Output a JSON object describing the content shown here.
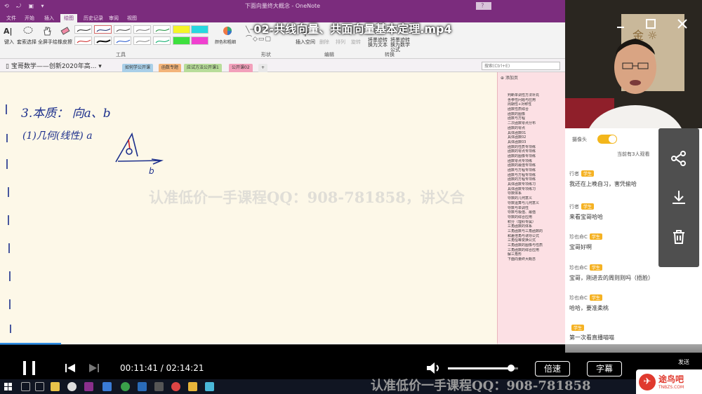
{
  "onenote": {
    "window_title": "下面向量终大概念 - OneNote",
    "quick_access": "⟲ ⤾ ▣ ▾",
    "help_label": "？",
    "tabs": [
      "文件",
      "开始",
      "插入",
      "绘图",
      "历史记录",
      "审阅",
      "视图"
    ],
    "active_tab": "绘图",
    "ribbon": {
      "tools": [
        "键入",
        "套索选择",
        "全屏手绘",
        "橡皮擦"
      ],
      "group_tools": "工具",
      "group_shapes": "形状",
      "group_edit": "编辑",
      "group_convert": "转换",
      "color_thickness": "颜色和粗细",
      "insert_space": "插入空间",
      "delete": "删除",
      "arrange": "排列",
      "rotate": "旋转",
      "ink_to_text": "将墨迹转换为文本",
      "ink_to_math": "将墨迹转换为数学公式"
    },
    "notebook_name": "宝哥数学——创新2020年高...",
    "sections": [
      {
        "label": "如何学公开课",
        "color": "#a9cfe8"
      },
      {
        "label": "函数专题",
        "color": "#f3b47a"
      },
      {
        "label": "应试方法公开课1",
        "color": "#b8dd9a"
      },
      {
        "label": "公开课02",
        "color": "#f2a0bb"
      },
      {
        "label": "+",
        "color": "#e8e8e8"
      }
    ],
    "search_placeholder": "搜索(Ctrl+E)",
    "add_page": "添加页",
    "pages": [
      "判断单调性方法补充",
      "含参性问题与应用",
      "周期性+对称性",
      "函数性质综合",
      "函数的图像",
      "函数与方程",
      "二次函数零点分布",
      "函数的零点",
      "具体函数01",
      "具体函数02",
      "具体函数03",
      "函数的性质专项练",
      "函数的零点专项练",
      "函数的图像专项练",
      "函数零点专项练",
      "函数的最值专项练",
      "函数与方程专项练",
      "函数与方程专项练",
      "函数的方程专项练",
      "具体函数专项练习",
      "具体函数专项练习",
      "导数体系",
      "导数的几何意义",
      "导数运算与几何意义",
      "导数与单调性",
      "导数与极值、最值",
      "导数的综合应用",
      "积分（理科专属）",
      "三角函数的体系",
      "三角函数与三角函数的",
      "和差倍角与诱导公式",
      "三角恒等变换公式",
      "三角函数的图像与性质",
      "三角函数的综合应用",
      "解三角形",
      "下面向量终大概念"
    ]
  },
  "note": {
    "line1": "3.本质：  向a、b",
    "line2": "(1)几何(线性)  a",
    "label_b": "b"
  },
  "video": {
    "title": "02-共线向量、共面向量基本定理.mp4",
    "watermark": "认准低价一手课程QQ：908-781858，讲义合",
    "watermark_bottom": "认准低价一手课程QQ：908-781858",
    "current_time": "00:11:41",
    "duration": "02:14:21",
    "progress_fraction": 0.087,
    "volume_fraction": 0.9,
    "speed_label": "倍速",
    "subtitle_label": "字幕",
    "send_label": "发送"
  },
  "chat": {
    "camera_label": "摄像头",
    "viewers": "当前有3人观看",
    "messages": [
      {
        "who": "行者",
        "badge": "学生",
        "text": "我还在上晚自习，害凭偷哈"
      },
      {
        "who": "行者",
        "badge": "学生",
        "text": "来看宝哥哈哈"
      },
      {
        "who": "珍也命C",
        "badge": "学生",
        "text": "宝哥好啊"
      },
      {
        "who": "珍也命C",
        "badge": "学生",
        "text": "宝哥，刚进去的周则则吗（捂脸）"
      },
      {
        "who": "珍也命C",
        "badge": "学生",
        "text": "哈哈，要准柔桃"
      },
      {
        "who": "",
        "badge": "学生",
        "text": "第一次看直播喵喵"
      }
    ]
  },
  "logo": {
    "name": "途鸟吧",
    "domain": "TNBZS.COM"
  },
  "colors": {
    "onenote_purple": "#7b2c7d",
    "accent_blue": "#2f8de4",
    "badge_gold": "#f5b223"
  }
}
